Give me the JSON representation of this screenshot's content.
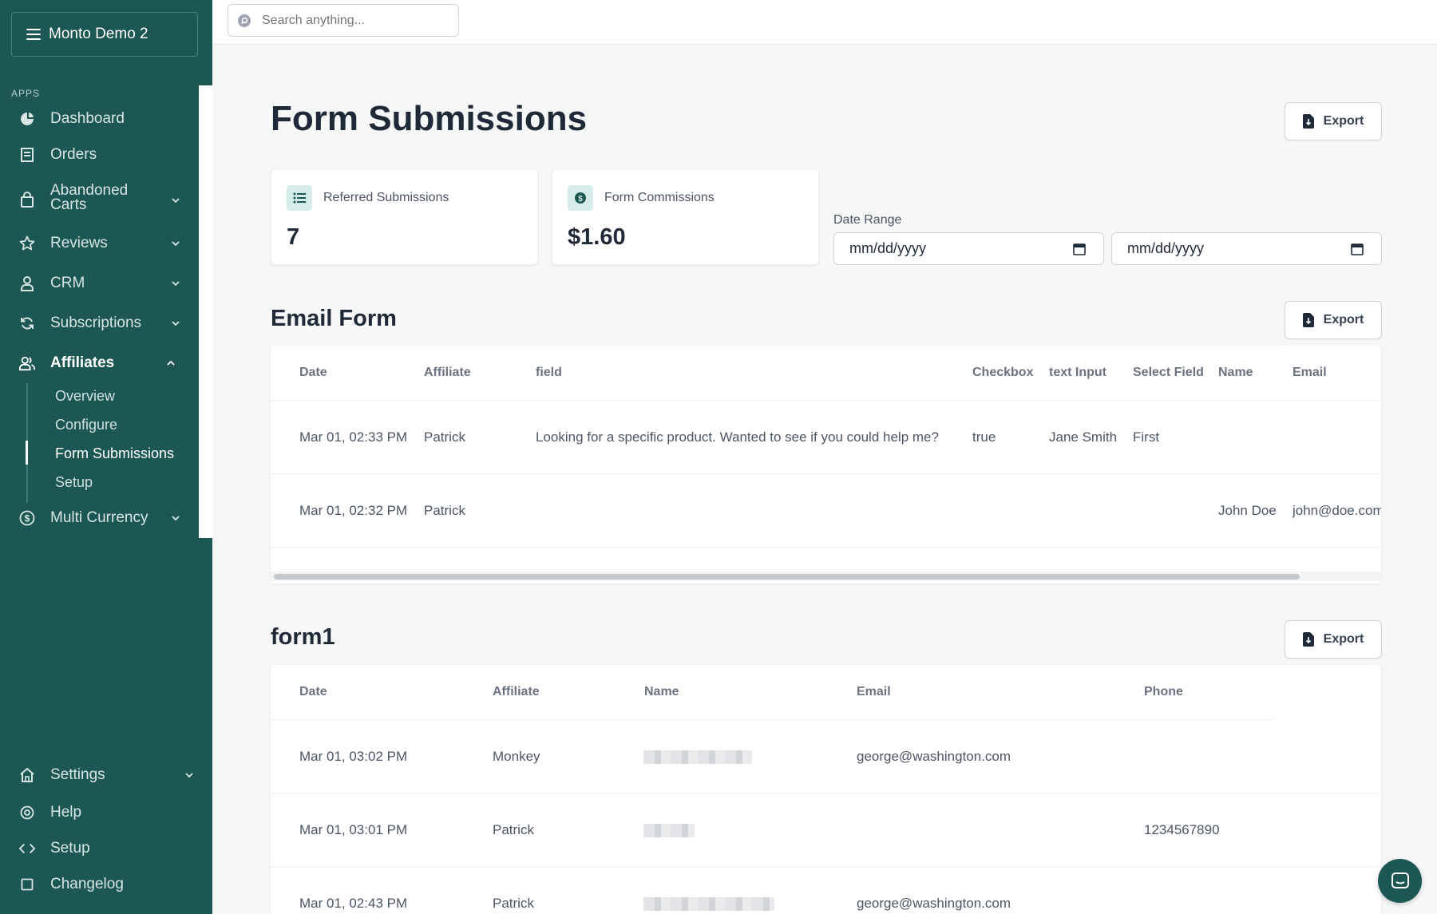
{
  "sidebar": {
    "store_name": "Monto Demo 2",
    "apps_label": "APPS",
    "items": [
      {
        "label": "Dashboard"
      },
      {
        "label": "Orders"
      },
      {
        "label": "Abandoned",
        "label2": "Carts"
      },
      {
        "label": "Reviews"
      },
      {
        "label": "CRM"
      },
      {
        "label": "Subscriptions"
      },
      {
        "label": "Affiliates"
      },
      {
        "label": "Multi Currency"
      }
    ],
    "affiliates_sub": [
      {
        "label": "Overview"
      },
      {
        "label": "Configure"
      },
      {
        "label": "Form Submissions"
      },
      {
        "label": "Setup"
      }
    ],
    "bottom_items": [
      {
        "label": "Settings"
      },
      {
        "label": "Help"
      },
      {
        "label": "Setup"
      },
      {
        "label": "Changelog"
      }
    ]
  },
  "search": {
    "placeholder": "Search anything..."
  },
  "page": {
    "title": "Form Submissions",
    "export_label": "Export"
  },
  "stats": [
    {
      "label": "Referred Submissions",
      "value": "7",
      "icon": "list-icon"
    },
    {
      "label": "Form Commissions",
      "value": "$1.60",
      "icon": "dollar-icon"
    }
  ],
  "date_range": {
    "label": "Date Range",
    "start_placeholder": "mm/dd/yyyy",
    "end_placeholder": "mm/dd/yyyy"
  },
  "email_form": {
    "title": "Email Form",
    "headers": [
      "Date",
      "Affiliate",
      "field",
      "Checkbox",
      "text Input",
      "Select Field",
      "Name",
      "Email"
    ],
    "rows": [
      [
        "Mar 01, 02:33 PM",
        "Patrick",
        "Looking for a specific product. Wanted to see if you could help me?",
        "true",
        "Jane Smith",
        "First",
        "",
        ""
      ],
      [
        "Mar 01, 02:32 PM",
        "Patrick",
        "",
        "",
        "",
        "",
        "John Doe",
        "john@doe.com"
      ]
    ]
  },
  "form1": {
    "title": "form1",
    "headers": [
      "Date",
      "Affiliate",
      "Name",
      "Email",
      "Phone"
    ],
    "rows": [
      [
        "Mar 01, 03:02 PM",
        "Monkey",
        "",
        "george@washington.com",
        ""
      ],
      [
        "Mar 01, 03:01 PM",
        "Patrick",
        "",
        "",
        "1234567890"
      ],
      [
        "Mar 01, 02:43 PM",
        "Patrick",
        "",
        "george@washington.com",
        ""
      ]
    ]
  },
  "colors": {
    "sidebar_bg": "#1d5753",
    "accent_badge": "#d5ecea"
  }
}
